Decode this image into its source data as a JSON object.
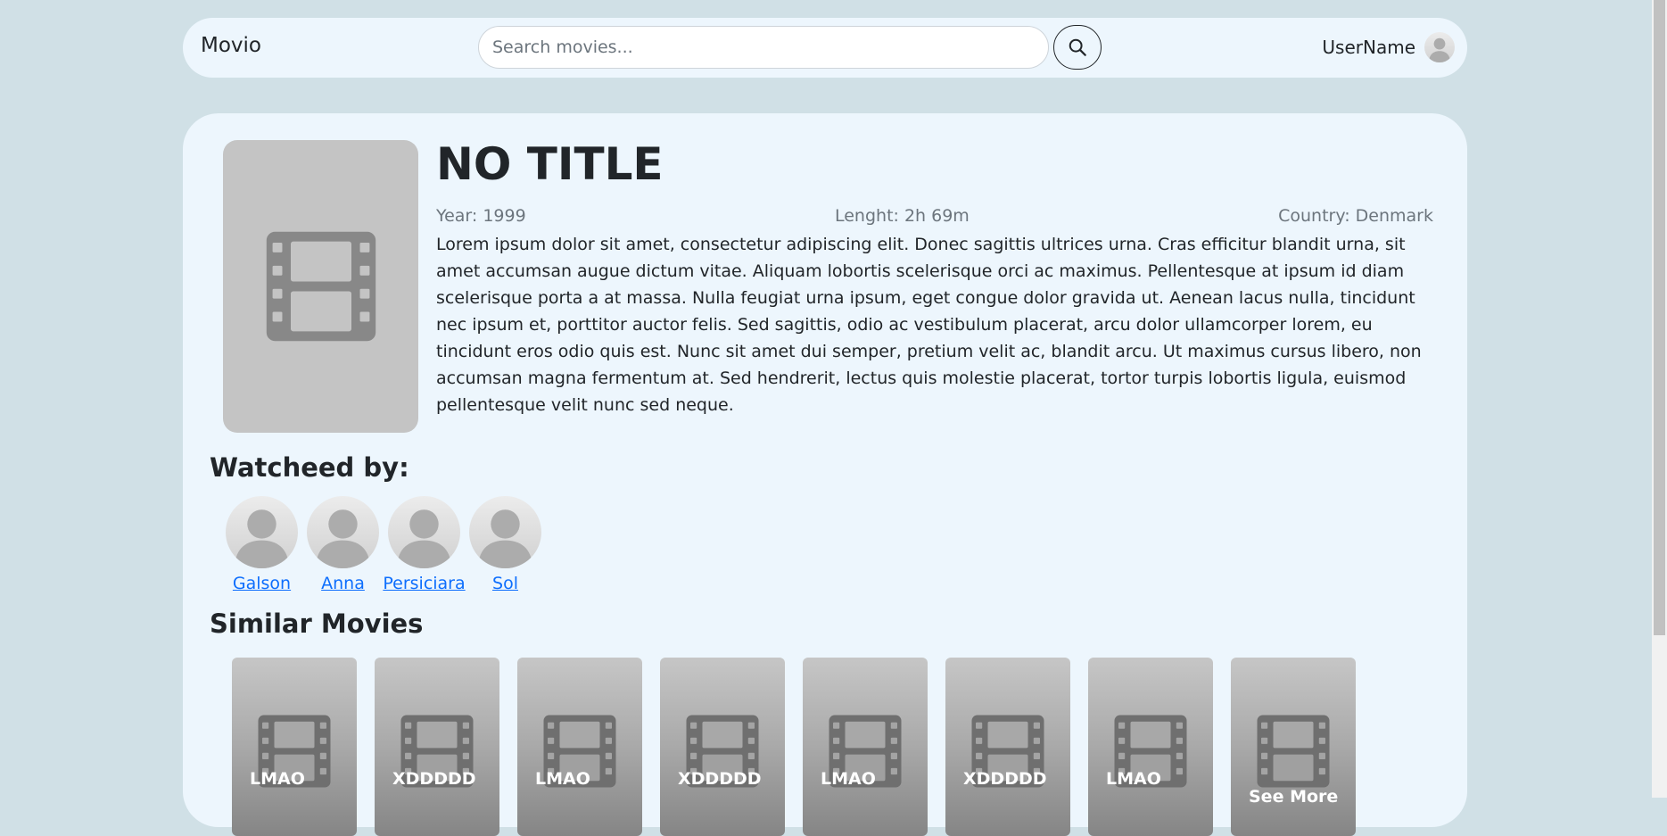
{
  "navbar": {
    "brand": "Movio",
    "search_placeholder": "Search movies...",
    "search_icon": "search-icon",
    "user_name": "UserName",
    "avatar_icon": "user-avatar-icon"
  },
  "movie": {
    "title": "NO TITLE",
    "year": "Year: 1999",
    "length": "Lenght: 2h 69m",
    "country": "Country: Denmark",
    "description": "Lorem ipsum dolor sit amet, consectetur adipiscing elit. Donec sagittis ultrices urna. Cras efficitur blandit urna, sit amet accumsan augue dictum vitae. Aliquam lobortis scelerisque orci ac maximus. Pellentesque at ipsum id diam scelerisque porta a at massa. Nulla feugiat urna ipsum, eget congue dolor gravida ut. Aenean lacus nulla, tincidunt nec ipsum et, porttitor auctor felis. Sed sagittis, odio ac vestibulum placerat, arcu dolor ullamcorper lorem, eu tincidunt eros odio quis est. Nunc sit amet dui semper, pretium velit ac, blandit arcu. Ut maximus cursus libero, non accumsan magna fermentum at. Sed hendrerit, lectus quis molestie placerat, tortor turpis lobortis ligula, euismod pellentesque velit nunc sed neque.",
    "poster_icon": "film-icon"
  },
  "watched": {
    "heading": "Watcheed by:",
    "users": [
      "Galson",
      "Anna",
      "Persiciara",
      "Sol"
    ]
  },
  "similar": {
    "heading": "Similar Movies",
    "movies": [
      "LMAO",
      "XDDDDD",
      "LMAO",
      "XDDDDD",
      "LMAO",
      "XDDDDD",
      "LMAO",
      "See More"
    ]
  },
  "colors": {
    "background": "#d0e0e6",
    "panel": "#edf6fd",
    "link": "#0d6efd",
    "poster": "#c4c4c4"
  }
}
